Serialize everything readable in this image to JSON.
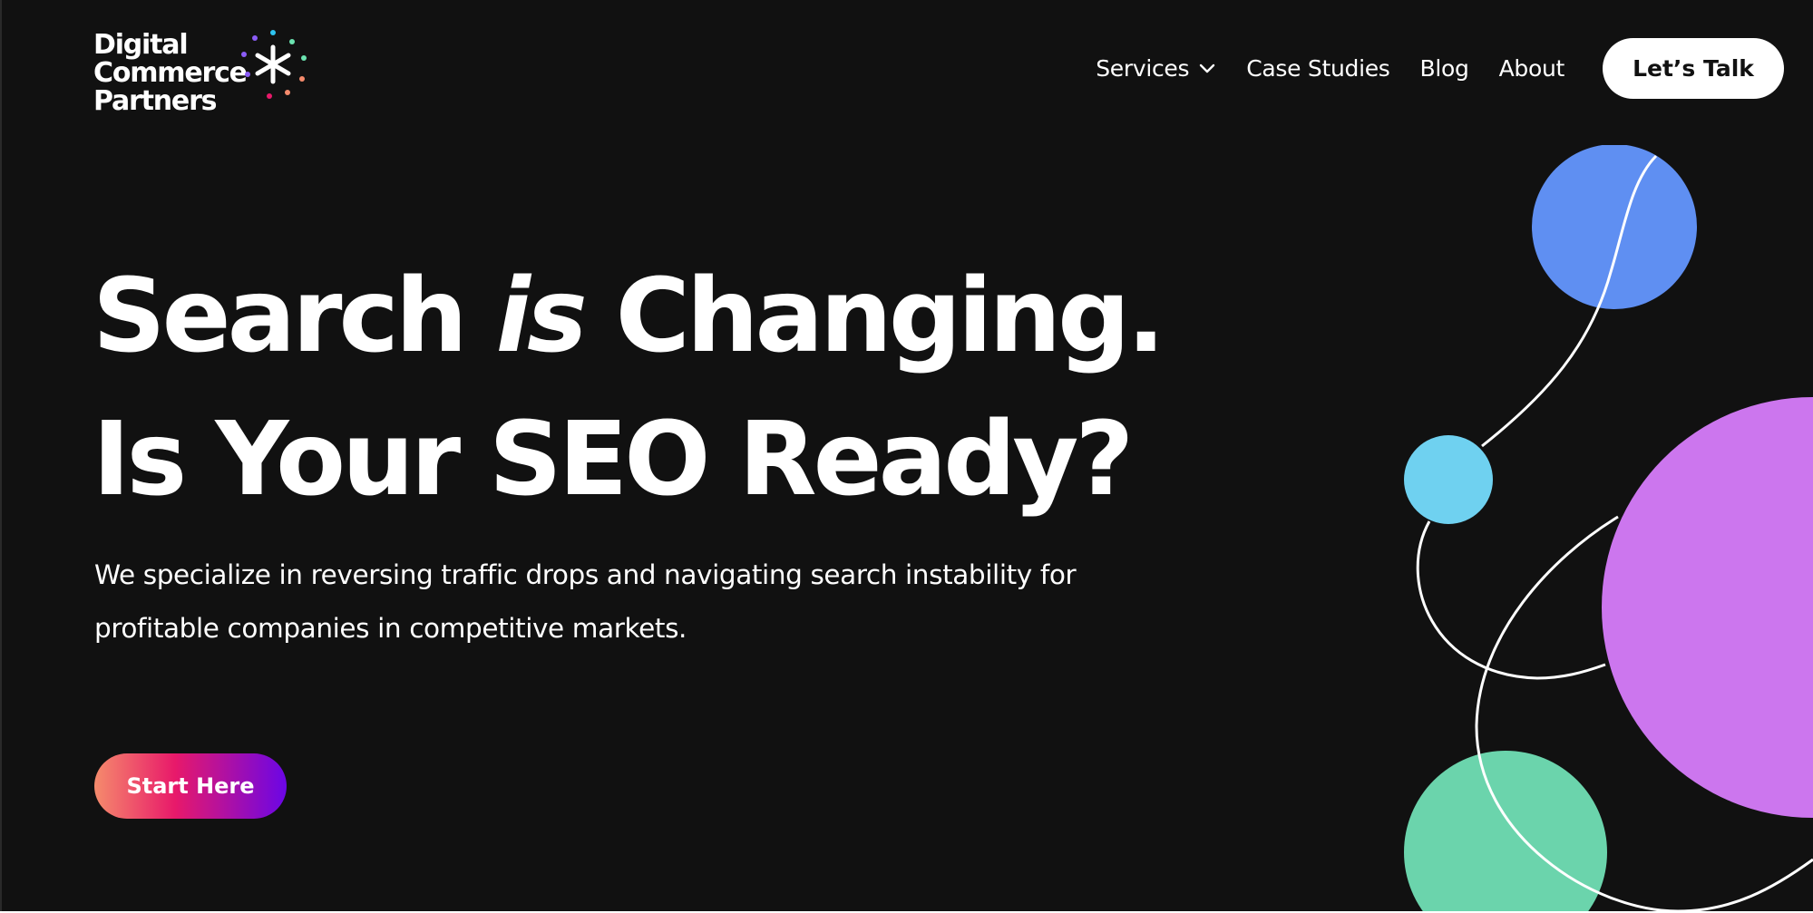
{
  "brand": {
    "logo_lines": [
      "Digital",
      "Commerce",
      "Partners"
    ],
    "mark_colors": [
      "#ffffff",
      "#f58b6c",
      "#e8196a",
      "#8b5cf6",
      "#6be3b0",
      "#2ec4f0"
    ]
  },
  "nav": {
    "items": [
      {
        "label": "Services",
        "has_dropdown": true
      },
      {
        "label": "Case Studies"
      },
      {
        "label": "Blog"
      },
      {
        "label": "About"
      }
    ],
    "cta_label": "Let’s Talk"
  },
  "hero": {
    "headline_line1_a": "Search",
    "headline_line1_em": "is",
    "headline_line1_b": "Changing.",
    "headline_line2": "Is Your SEO Ready?",
    "subtext": "We specialize in reversing traffic drops and navigating search instability for profitable companies in competitive markets.",
    "cta_label": "Start Here"
  },
  "colors": {
    "background": "#111111",
    "text": "#ffffff",
    "circle_blue": "#5f8ff2",
    "circle_cyan": "#6fd1f0",
    "circle_purple": "#cc76ee",
    "circle_green": "#6bd4ac",
    "cta_gradient": [
      "#f58b6c",
      "#e8196a",
      "#6b06e6"
    ]
  }
}
